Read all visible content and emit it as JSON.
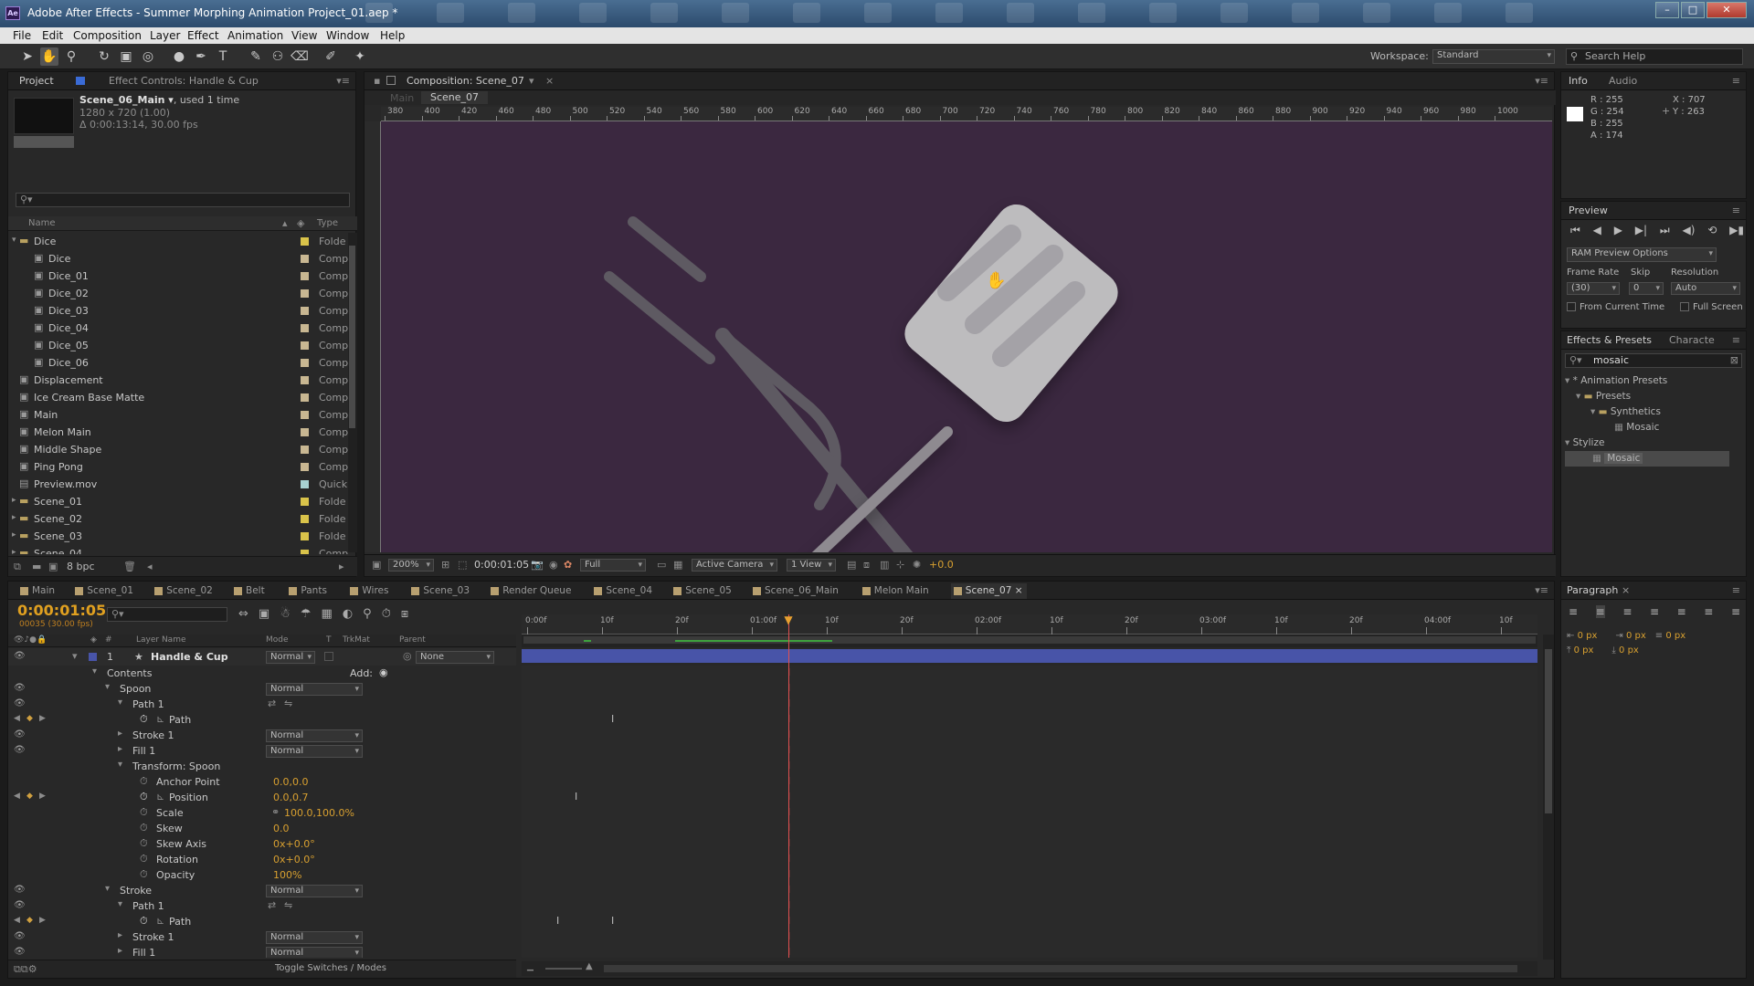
{
  "window": {
    "title": "Adobe After Effects - Summer Morphing Animation Project_01.aep *",
    "logo": "Ae",
    "minimize": "–",
    "maximize": "□",
    "close": "✕"
  },
  "menu": [
    "File",
    "Edit",
    "Composition",
    "Layer",
    "Effect",
    "Animation",
    "View",
    "Window",
    "Help"
  ],
  "toolbar": {
    "workspace_label": "Workspace:",
    "workspace_value": "Standard",
    "search_placeholder": "Search Help"
  },
  "project": {
    "tab_project": "Project",
    "tab_effects": "Effect Controls: Handle & Cup",
    "comp_name": "Scene_06_Main ▾",
    "comp_used": ", used 1 time",
    "comp_res": "1280 x 720 (1.00)",
    "comp_dur": "Δ 0:00:13:14, 30.00 fps",
    "col_name": "Name",
    "col_type": "Type",
    "bpc": "8 bpc",
    "items": [
      {
        "name": "Dice",
        "type": "Folde",
        "color": "#d9c34a",
        "indent": 0,
        "kind": "folder",
        "open": true
      },
      {
        "name": "Dice",
        "type": "Comp",
        "color": "#c8b792",
        "indent": 1,
        "kind": "comp"
      },
      {
        "name": "Dice_01",
        "type": "Comp",
        "color": "#c8b792",
        "indent": 1,
        "kind": "comp"
      },
      {
        "name": "Dice_02",
        "type": "Comp",
        "color": "#c8b792",
        "indent": 1,
        "kind": "comp"
      },
      {
        "name": "Dice_03",
        "type": "Comp",
        "color": "#c8b792",
        "indent": 1,
        "kind": "comp"
      },
      {
        "name": "Dice_04",
        "type": "Comp",
        "color": "#c8b792",
        "indent": 1,
        "kind": "comp"
      },
      {
        "name": "Dice_05",
        "type": "Comp",
        "color": "#c8b792",
        "indent": 1,
        "kind": "comp"
      },
      {
        "name": "Dice_06",
        "type": "Comp",
        "color": "#c8b792",
        "indent": 1,
        "kind": "comp"
      },
      {
        "name": "Displacement",
        "type": "Comp",
        "color": "#c8b792",
        "indent": 0,
        "kind": "comp"
      },
      {
        "name": "Ice Cream Base Matte",
        "type": "Comp",
        "color": "#c8b792",
        "indent": 0,
        "kind": "comp"
      },
      {
        "name": "Main",
        "type": "Comp",
        "color": "#c8b792",
        "indent": 0,
        "kind": "comp"
      },
      {
        "name": "Melon Main",
        "type": "Comp",
        "color": "#c8b792",
        "indent": 0,
        "kind": "comp"
      },
      {
        "name": "Middle Shape",
        "type": "Comp",
        "color": "#c8b792",
        "indent": 0,
        "kind": "comp"
      },
      {
        "name": "Ping Pong",
        "type": "Comp",
        "color": "#c8b792",
        "indent": 0,
        "kind": "comp"
      },
      {
        "name": "Preview.mov",
        "type": "Quick",
        "color": "#a8d2d2",
        "indent": 0,
        "kind": "file"
      },
      {
        "name": "Scene_01",
        "type": "Folde",
        "color": "#d9c34a",
        "indent": 0,
        "kind": "folder"
      },
      {
        "name": "Scene_02",
        "type": "Folde",
        "color": "#d9c34a",
        "indent": 0,
        "kind": "folder"
      },
      {
        "name": "Scene_03",
        "type": "Folde",
        "color": "#d9c34a",
        "indent": 0,
        "kind": "folder"
      },
      {
        "name": "Scene_04",
        "type": "Comp",
        "color": "#d9c34a",
        "indent": 0,
        "kind": "folder"
      }
    ]
  },
  "composition": {
    "tab": "Composition: Scene_07",
    "crumb_main": "Main",
    "crumb_scene": "Scene_07",
    "ruler": [
      "380",
      "400",
      "420",
      "460",
      "480",
      "500",
      "520",
      "540",
      "560",
      "580",
      "600",
      "620",
      "640",
      "660",
      "680",
      "700",
      "720",
      "740",
      "760",
      "780",
      "800",
      "820",
      "840",
      "860",
      "880",
      "900",
      "920",
      "940",
      "960",
      "980",
      "1000"
    ],
    "zoom": "200%",
    "timecode": "0:00:01:05",
    "resolution": "Full",
    "camera": "Active Camera",
    "views": "1 View",
    "exposure": "+0.0"
  },
  "info": {
    "tab": "Info",
    "tab2": "Audio",
    "r": "R : 255",
    "g": "G : 254",
    "b": "B : 255",
    "a": "A : 174",
    "x": "X : 707",
    "y": "Y : 263"
  },
  "preview": {
    "tab": "Preview",
    "ram": "RAM Preview Options",
    "frame_rate_label": "Frame Rate",
    "skip_label": "Skip",
    "resolution_label": "Resolution",
    "frame_rate": "(30)",
    "skip": "0",
    "resolution": "Auto",
    "from_current": "From Current Time",
    "full_screen": "Full Screen"
  },
  "effects": {
    "tab": "Effects & Presets",
    "tab2": "Characte",
    "search": "mosaic",
    "tree": [
      "* Animation Presets",
      "Presets",
      "Synthetics",
      "Mosaic",
      "Stylize",
      "Mosaic"
    ]
  },
  "paragraph": {
    "tab": "Paragraph",
    "v1": "0 px",
    "v2": "0 px",
    "v3": "0 px",
    "v4": "0 px",
    "v5": "0 px"
  },
  "timeline": {
    "tabs": [
      "Main",
      "Scene_01",
      "Scene_02",
      "Belt",
      "Pants",
      "Wires",
      "Scene_03",
      "Render Queue",
      "Scene_04",
      "Scene_05",
      "Scene_06_Main",
      "Melon Main",
      "Scene_07"
    ],
    "timecode": "0:00:01:05",
    "frames": "00035 (30.00 fps)",
    "cols": {
      "layer_name": "Layer Name",
      "mode": "Mode",
      "t": "T",
      "trkmat": "TrkMat",
      "parent": "Parent"
    },
    "ruler": [
      "0:00f",
      "10f",
      "20f",
      "01:00f",
      "10f",
      "20f",
      "02:00f",
      "10f",
      "20f",
      "03:00f",
      "10f",
      "20f",
      "04:00f",
      "10f"
    ],
    "layer_num": "1",
    "layer_name": "Handle & Cup",
    "layer_mode": "Normal",
    "parent": "None",
    "add": "Add:",
    "toggle": "Toggle Switches / Modes",
    "props": [
      {
        "label": "Contents",
        "indent": 0,
        "tw": "open"
      },
      {
        "label": "Spoon",
        "indent": 1,
        "tw": "open",
        "mode": "Normal",
        "eye": true
      },
      {
        "label": "Path 1",
        "indent": 2,
        "tw": "open",
        "eye": true,
        "icons": true
      },
      {
        "label": "Path",
        "indent": 3,
        "sw": true,
        "graph": true,
        "nav": true,
        "kf": [
          560
        ]
      },
      {
        "label": "Stroke 1",
        "indent": 2,
        "tw": "closed",
        "mode": "Normal",
        "eye": true
      },
      {
        "label": "Fill 1",
        "indent": 2,
        "tw": "closed",
        "mode": "Normal",
        "eye": true
      },
      {
        "label": "Transform: Spoon",
        "indent": 2,
        "tw": "open"
      },
      {
        "label": "Anchor Point",
        "indent": 3,
        "sw": true,
        "value": "0.0,0.0"
      },
      {
        "label": "Position",
        "indent": 3,
        "sw": true,
        "graph": true,
        "nav": true,
        "value": "0.0,0.7",
        "kf": [
          520
        ]
      },
      {
        "label": "Scale",
        "indent": 3,
        "sw": true,
        "value": "100.0,100.0%",
        "link": true
      },
      {
        "label": "Skew",
        "indent": 3,
        "sw": true,
        "value": "0.0"
      },
      {
        "label": "Skew Axis",
        "indent": 3,
        "sw": true,
        "value": "0x+0.0°"
      },
      {
        "label": "Rotation",
        "indent": 3,
        "sw": true,
        "value": "0x+0.0°"
      },
      {
        "label": "Opacity",
        "indent": 3,
        "sw": true,
        "value": "100%"
      },
      {
        "label": "Stroke",
        "indent": 1,
        "tw": "open",
        "mode": "Normal",
        "eye": true
      },
      {
        "label": "Path 1",
        "indent": 2,
        "tw": "open",
        "eye": true,
        "icons": true
      },
      {
        "label": "Path",
        "indent": 3,
        "sw": true,
        "graph": true,
        "nav": true,
        "kf": [
          500,
          560
        ]
      },
      {
        "label": "Stroke 1",
        "indent": 2,
        "tw": "closed",
        "mode": "Normal",
        "eye": true
      },
      {
        "label": "Fill 1",
        "indent": 2,
        "tw": "closed",
        "mode": "Normal",
        "eye": true
      }
    ]
  },
  "colors": {
    "comp_bg": "#3b2840",
    "layer_bar": "#4854a8",
    "timecode": "#e0a020",
    "playhead": "#e8a030"
  },
  "icons": [
    "hand-cursor-icon",
    "stopwatch-icon",
    "eye-icon",
    "folder-icon",
    "comp-icon",
    "magnifier-icon"
  ]
}
